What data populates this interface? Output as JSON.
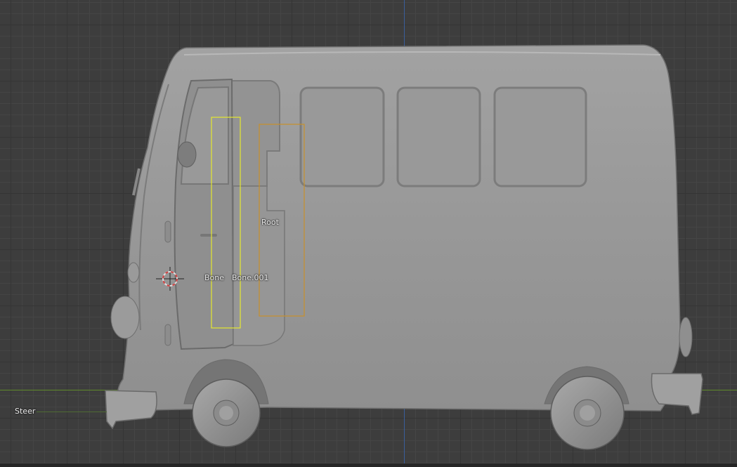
{
  "viewport": {
    "background": "#3d3d3d",
    "axis_x_color": "#5f8a2a",
    "axis_z_color": "#3a5e9c"
  },
  "bones": {
    "root": {
      "label": "Root",
      "color": "#c8902a"
    },
    "bone": {
      "label": "Bone",
      "color": "#e5e82e"
    },
    "bone001": {
      "label": "Bone.001"
    },
    "steer": {
      "label": "Steer"
    }
  },
  "icons": {
    "cursor": "3d-cursor-icon"
  }
}
